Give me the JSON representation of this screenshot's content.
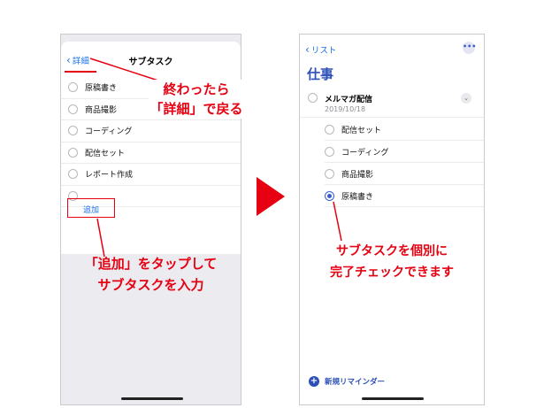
{
  "left_screen": {
    "back_label": "詳細",
    "title": "サブタスク",
    "subtasks": [
      "原稿書き",
      "商品撮影",
      "コーディング",
      "配信セット",
      "レポート作成",
      ""
    ],
    "add_label": "追加"
  },
  "right_screen": {
    "back_label": "リスト",
    "more_label": "•••",
    "list_title": "仕事",
    "task": {
      "name": "メルマガ配信",
      "date": "2019/10/18"
    },
    "subtasks": [
      {
        "label": "配信セット",
        "checked": false
      },
      {
        "label": "コーディング",
        "checked": false
      },
      {
        "label": "商品撮影",
        "checked": false
      },
      {
        "label": "原稿書き",
        "checked": true
      }
    ],
    "new_reminder_label": "新規リマインダー"
  },
  "annotations": {
    "callout_1_line1": "終わったら",
    "callout_1_line2": "「詳細」で戻る",
    "callout_2_line1": "「追加」をタップして",
    "callout_2_line2": "サブタスクを入力",
    "callout_3_line1": "サブタスクを個別に",
    "callout_3_line2": "完了チェックできます"
  },
  "colors": {
    "accent_red": "#e60012",
    "ios_blue": "#1a73e8",
    "list_blue": "#2c4fb8"
  }
}
